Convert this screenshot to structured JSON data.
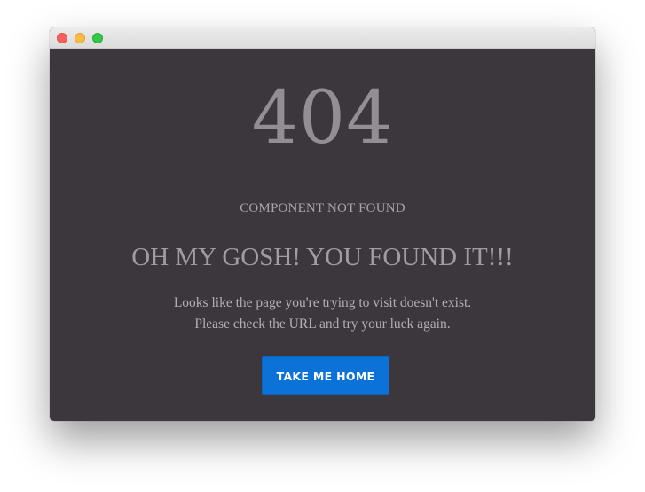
{
  "window": {
    "controls": [
      "close",
      "minimize",
      "maximize"
    ]
  },
  "error": {
    "code": "404",
    "subtitle": "COMPONENT NOT FOUND",
    "headline": "OH MY GOSH! YOU FOUND IT!!!",
    "message_line1": "Looks like the page you're trying to visit doesn't exist.",
    "message_line2": "Please check the URL and try your luck again."
  },
  "actions": {
    "home_label": "TAKE ME HOME"
  },
  "colors": {
    "background": "#3c373d",
    "button": "#0b72d8",
    "text_muted": "#938e94"
  }
}
